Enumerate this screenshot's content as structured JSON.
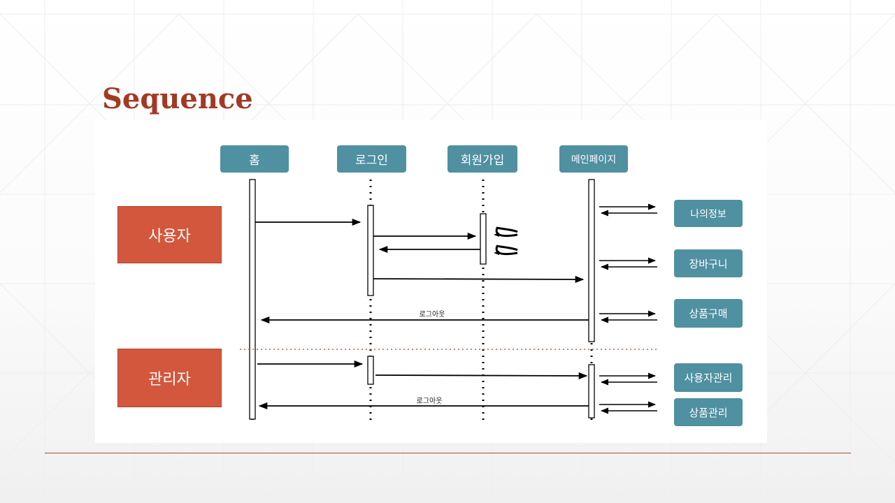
{
  "slide": {
    "title": "Sequence"
  },
  "participants": [
    "홈",
    "로그인",
    "회원가입",
    "메인페이지"
  ],
  "actors": {
    "user": "사용자",
    "admin": "관리자"
  },
  "menus": {
    "user": [
      "나의정보",
      "장바구니",
      "상품구매"
    ],
    "admin": [
      "사용자관리",
      "상품관리"
    ]
  },
  "messages": {
    "logout_user": "로그아웃",
    "logout_admin": "로그아웃"
  },
  "colors": {
    "title": "#a23a23",
    "teal": "#4f90a1",
    "actor": "#d3573c",
    "divider": "#d9534f"
  }
}
